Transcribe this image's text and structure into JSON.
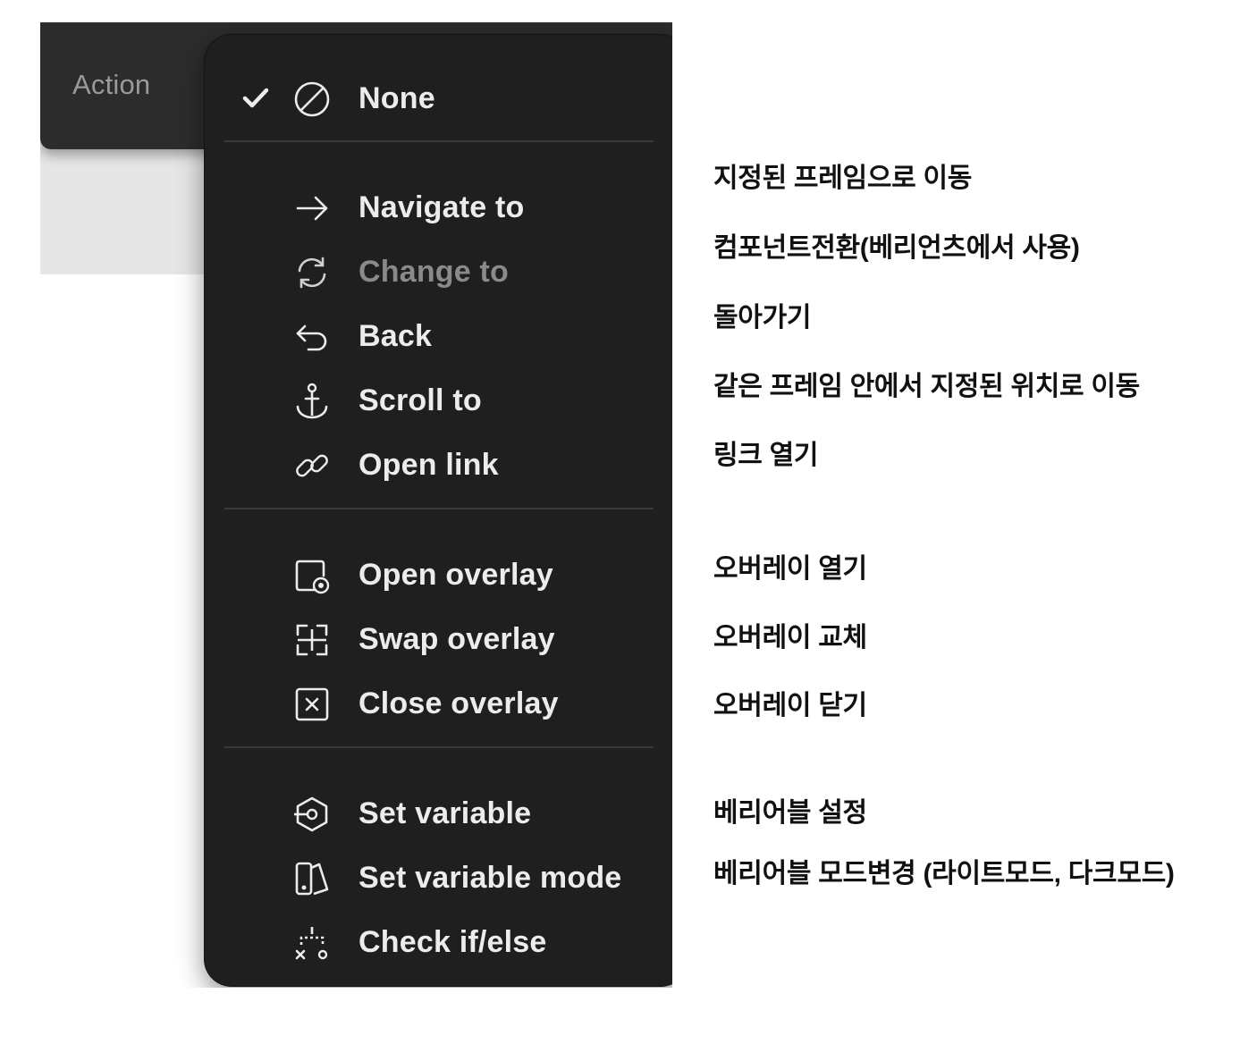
{
  "panel": {
    "action_label": "Action"
  },
  "menu": {
    "selected": "None",
    "items": [
      {
        "label": "None",
        "icon": "none-icon",
        "checked": true,
        "disabled": false
      },
      {
        "label": "Navigate to",
        "icon": "arrow-right-icon",
        "disabled": false
      },
      {
        "label": "Change to",
        "icon": "refresh-icon",
        "disabled": true
      },
      {
        "label": "Back",
        "icon": "back-arrow-icon",
        "disabled": false
      },
      {
        "label": "Scroll to",
        "icon": "anchor-icon",
        "disabled": false
      },
      {
        "label": "Open link",
        "icon": "link-icon",
        "disabled": false
      },
      {
        "label": "Open overlay",
        "icon": "open-overlay-icon",
        "disabled": false
      },
      {
        "label": "Swap overlay",
        "icon": "swap-overlay-icon",
        "disabled": false
      },
      {
        "label": "Close overlay",
        "icon": "close-overlay-icon",
        "disabled": false
      },
      {
        "label": "Set variable",
        "icon": "set-variable-icon",
        "disabled": false
      },
      {
        "label": "Set variable mode",
        "icon": "variable-mode-icon",
        "disabled": false
      },
      {
        "label": "Check if/else",
        "icon": "conditional-icon",
        "disabled": false
      }
    ]
  },
  "annotations": [
    "지정된 프레임으로 이동",
    "컴포넌트전환(베리언츠에서 사용)",
    "돌아가기",
    "같은 프레임 안에서 지정된 위치로 이동",
    "링크 열기",
    "오버레이 열기",
    "오버레이 교체",
    "오버레이 닫기",
    "베리어블 설정",
    "베리어블 모드변경 (라이트모드, 다크모드)"
  ],
  "colors": {
    "menu_bg": "#1f1f1f",
    "bar_bg": "#2c2c2c",
    "label_text": "#ececec",
    "disabled_text": "#8a8a8a",
    "annotation_text": "#111111"
  }
}
